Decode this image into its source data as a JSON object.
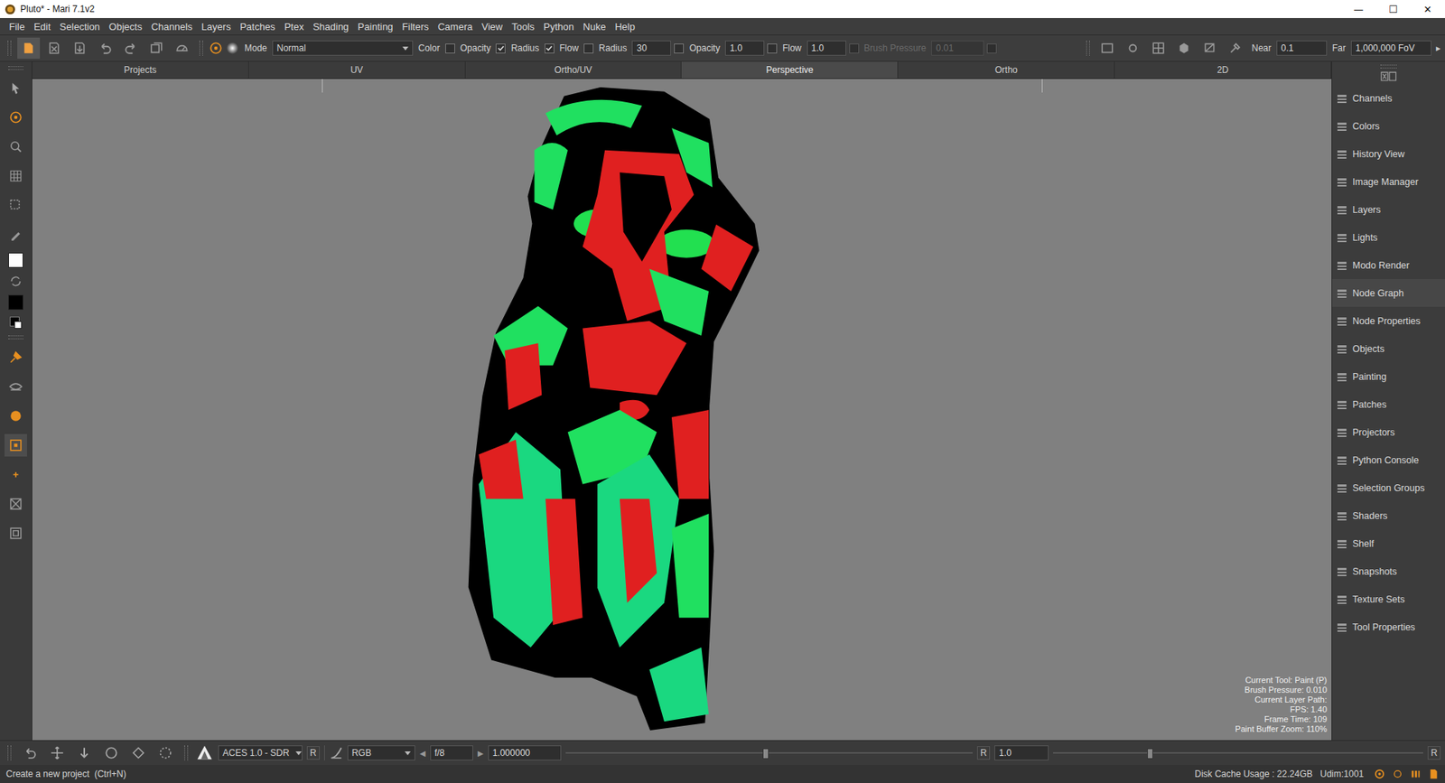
{
  "window": {
    "title": "Pluto* - Mari 7.1v2",
    "controls": [
      "—",
      "☐",
      "✕"
    ]
  },
  "menu": [
    "File",
    "Edit",
    "Selection",
    "Objects",
    "Channels",
    "Layers",
    "Patches",
    "Ptex",
    "Shading",
    "Painting",
    "Filters",
    "Camera",
    "View",
    "Tools",
    "Python",
    "Nuke",
    "Help"
  ],
  "toolbar": {
    "mode": {
      "label": "Mode",
      "value": "Normal"
    },
    "pressure_label": "Color",
    "pressure_toggles": [
      {
        "label": "Opacity",
        "checked": false
      },
      {
        "label": "Radius",
        "checked": true
      },
      {
        "label": "Flow",
        "checked": true
      }
    ],
    "fields": [
      {
        "label": "Radius",
        "value": "30",
        "checked": false,
        "disabled": false
      },
      {
        "label": "Opacity",
        "value": "1.0",
        "checked": false,
        "disabled": false
      },
      {
        "label": "Flow",
        "value": "1.0",
        "checked": false,
        "disabled": false
      },
      {
        "label": "Brush Pressure",
        "value": "0.01",
        "checked": false,
        "disabled": true
      }
    ],
    "trailing_checked": false,
    "near": {
      "label": "Near",
      "value": "0.1"
    },
    "far": {
      "label": "Far",
      "value": "1,000,000",
      "unit": "FoV"
    },
    "more": "▸"
  },
  "tabs": [
    {
      "label": "Projects",
      "selected": false
    },
    {
      "label": "UV",
      "selected": false
    },
    {
      "label": "Ortho/UV",
      "selected": false
    },
    {
      "label": "Perspective",
      "selected": true
    },
    {
      "label": "Ortho",
      "selected": false
    },
    {
      "label": "2D",
      "selected": false
    }
  ],
  "paint_colors": {
    "foreground": "#ffffff",
    "background": "#000000"
  },
  "viewport": {
    "info": [
      "Current Tool: Paint (P)",
      "Brush Pressure: 0.010",
      "Current Layer Path:",
      "FPS: 1.40",
      "Frame Time: 109",
      "Paint Buffer Zoom: 110%"
    ]
  },
  "palettes": {
    "items": [
      {
        "label": "Channels",
        "selected": false
      },
      {
        "label": "Colors",
        "selected": false
      },
      {
        "label": "History View",
        "selected": false
      },
      {
        "label": "Image Manager",
        "selected": false
      },
      {
        "label": "Layers",
        "selected": false
      },
      {
        "label": "Lights",
        "selected": false
      },
      {
        "label": "Modo Render",
        "selected": false
      },
      {
        "label": "Node Graph",
        "selected": true
      },
      {
        "label": "Node Properties",
        "selected": false
      },
      {
        "label": "Objects",
        "selected": false
      },
      {
        "label": "Painting",
        "selected": false
      },
      {
        "label": "Patches",
        "selected": false
      },
      {
        "label": "Projectors",
        "selected": false
      },
      {
        "label": "Python Console",
        "selected": false
      },
      {
        "label": "Selection Groups",
        "selected": false
      },
      {
        "label": "Shaders",
        "selected": false
      },
      {
        "label": "Shelf",
        "selected": false
      },
      {
        "label": "Snapshots",
        "selected": false
      },
      {
        "label": "Texture Sets",
        "selected": false
      },
      {
        "label": "Tool Properties",
        "selected": false
      }
    ]
  },
  "bottom_bar": {
    "colorspace": "ACES 1.0 - SDR",
    "colorspace_button": "R",
    "channel": "RGB",
    "prev": "◀",
    "fstop": "f/8",
    "next": "▶",
    "exposure": "1.000000",
    "exposure_level": 0.49,
    "gain_label": "R",
    "gain": "1.0",
    "gain_level": 0.26,
    "reset": "R"
  },
  "status_bar": {
    "message": "Create a new project  (Ctrl+N)",
    "disk_cache": "Disk Cache Usage : 22.24GB",
    "udim": "Udim:1001"
  }
}
